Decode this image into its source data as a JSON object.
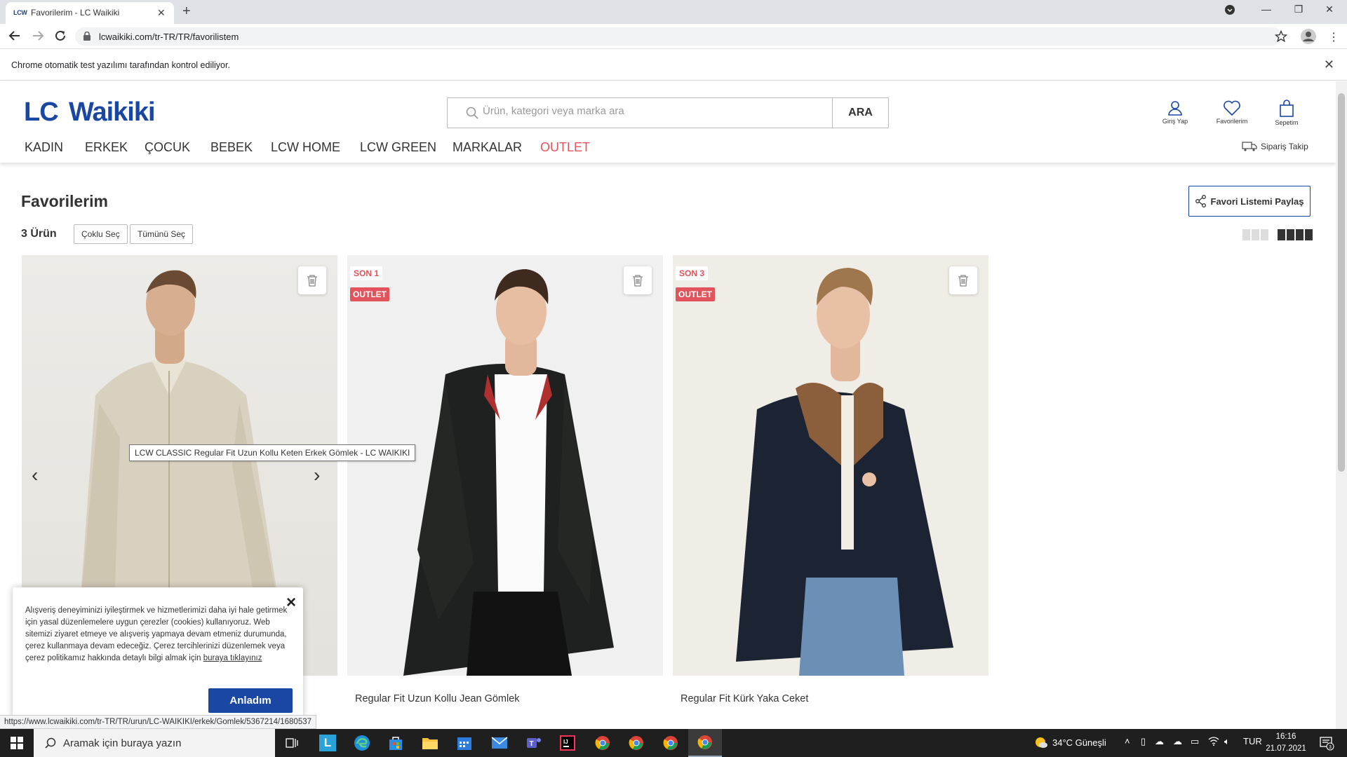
{
  "browser": {
    "tab_favicon": "LCW",
    "tab_title": "Favorilerim - LC Waikiki",
    "url": "lcwaikiki.com/tr-TR/TR/favorilistem",
    "infobar_message": "Chrome otomatik test yazılımı tarafından kontrol ediliyor.",
    "status_url": "https://www.lcwaikiki.com/tr-TR/TR/urun/LC-WAIKIKI/erkek/Gomlek/5367214/1680537"
  },
  "header": {
    "logo_text": "LC Waikiki",
    "search_placeholder": "Ürün, kategori veya marka ara",
    "search_button": "ARA",
    "icons": [
      {
        "label": "Giriş Yap",
        "icon": "user-icon"
      },
      {
        "label": "Favorilerim",
        "icon": "heart-icon"
      },
      {
        "label": "Sepetim",
        "icon": "bag-icon"
      }
    ],
    "categories": [
      "KADIN",
      "ERKEK",
      "ÇOCUK",
      "BEBEK",
      "LCW HOME",
      "LCW GREEN",
      "MARKALAR",
      "OUTLET"
    ],
    "order_tracking": "Sipariş Takip"
  },
  "page": {
    "title": "Favorilerim",
    "share_button": "Favori Listemi Paylaş",
    "count": "3 Ürün",
    "multi_select": "Çoklu Seç",
    "select_all": "Tümünü Seç"
  },
  "products": [
    {
      "name": "LCW CLASSIC Regular Fit Uzun Kollu Keten Erkek Gömlek",
      "badge_stock": "",
      "badge_outlet": ""
    },
    {
      "name": "Regular Fit Uzun Kollu Jean Gömlek",
      "badge_stock": "SON 1",
      "badge_outlet": "OUTLET"
    },
    {
      "name": "Regular Fit Kürk Yaka Ceket",
      "badge_stock": "SON 3",
      "badge_outlet": "OUTLET"
    }
  ],
  "tooltip": "LCW CLASSIC Regular Fit Uzun Kollu Keten Erkek Gömlek - LC WAIKIKI",
  "cookie": {
    "text": "Alışveriş deneyiminizi iyileştirmek ve hizmetlerimizi daha iyi hale getirmek için yasal düzenlemelere uygun çerezler (cookies) kullanıyoruz. Web sitemizi ziyaret etmeye ve alışveriş yapmaya devam etmeniz durumunda, çerez kullanmaya devam edeceğiz. Çerez tercihlerinizi düzenlemek veya çerez politikamız hakkında detaylı bilgi almak için",
    "link": "buraya tıklayınız",
    "accept": "Anladım"
  },
  "taskbar": {
    "search_placeholder": "Aramak için buraya yazın",
    "weather": "34°C Güneşli",
    "language": "TUR",
    "time": "16:16",
    "date": "21.07.2021",
    "notifications": "3"
  },
  "colors": {
    "brand_blue": "#1a47a3",
    "outlet_red": "#e2545c"
  }
}
